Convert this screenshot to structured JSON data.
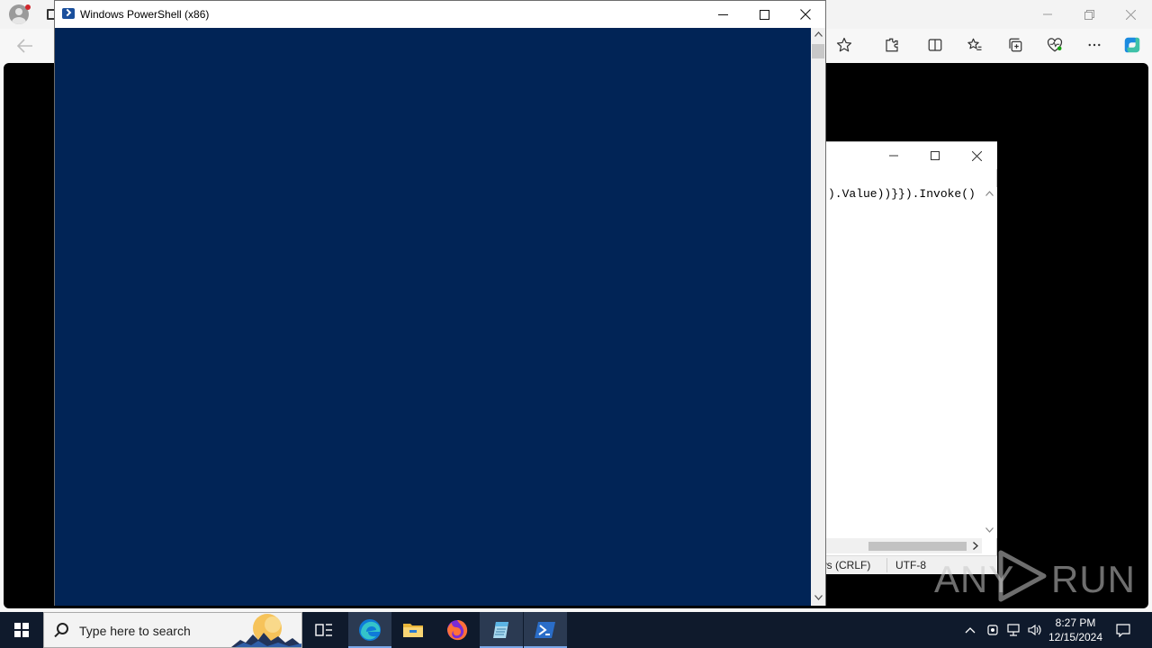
{
  "powershell": {
    "title": "Windows PowerShell (x86)",
    "console_color": "#012456"
  },
  "notepad": {
    "visible_text": ").Value))}}).Invoke()",
    "status_line_ending": "ws (CRLF)",
    "status_encoding": "UTF-8"
  },
  "watermark": {
    "left": "ANY",
    "right": "RUN"
  },
  "taskbar": {
    "search_placeholder": "Type here to search",
    "clock_time": "8:27 PM",
    "clock_date": "12/15/2024",
    "apps": [
      "task-view",
      "edge",
      "file-explorer",
      "firefox",
      "notepad",
      "powershell"
    ],
    "active_app": "powershell"
  },
  "colors": {
    "taskbar_bg": "#0f1a2c",
    "edge_accent": "#0f7bd8",
    "firefox_orange": "#ff7139"
  }
}
